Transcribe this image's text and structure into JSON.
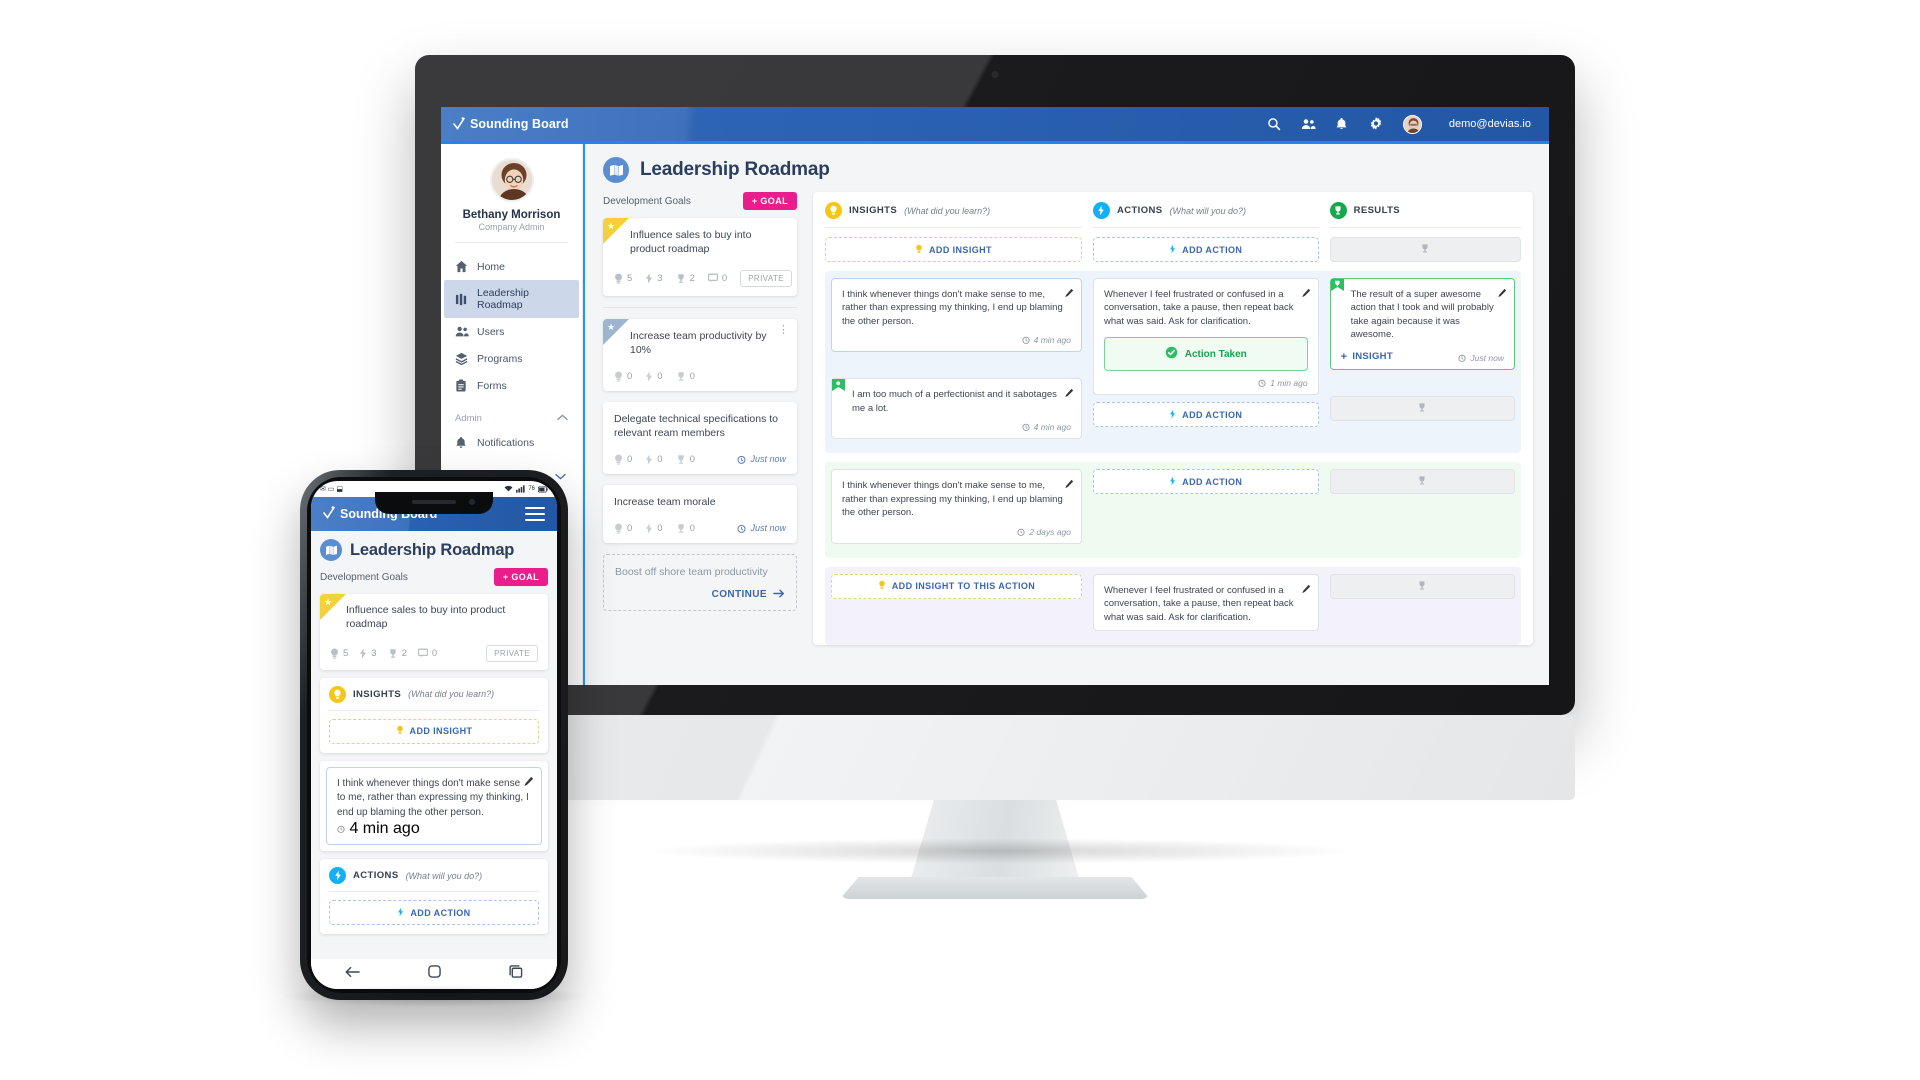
{
  "app": {
    "brand": "Sounding Board",
    "user_email": "demo@devias.io",
    "nav_icons": [
      "search-icon",
      "users-icon",
      "bell-icon",
      "gear-icon",
      "avatar"
    ]
  },
  "sidebar": {
    "profile_name": "Bethany Morrison",
    "profile_role": "Company Admin",
    "items": [
      {
        "label": "Home",
        "icon": "home-icon",
        "active": false
      },
      {
        "label": "Leadership Roadmap",
        "icon": "roadmap-icon",
        "active": true
      },
      {
        "label": "Users",
        "icon": "users-icon",
        "active": false
      },
      {
        "label": "Programs",
        "icon": "layers-icon",
        "active": false
      },
      {
        "label": "Forms",
        "icon": "clipboard-icon",
        "active": false
      }
    ],
    "group_label": "Admin",
    "admin_items": [
      {
        "label": "Notifications",
        "icon": "bell-icon"
      }
    ]
  },
  "page": {
    "title": "Leadership Roadmap",
    "icon": "map-book-icon"
  },
  "goals": {
    "section_label": "Development Goals",
    "add_button": "+ GOAL",
    "cards": [
      {
        "title": "Influence sales to buy into product roadmap",
        "flag": "yellow",
        "insights": "5",
        "actions": "3",
        "results": "2",
        "comments": "0",
        "badge": "PRIVATE",
        "time": ""
      },
      {
        "title": "Increase team productivity by 10%",
        "flag": "blue",
        "insights": "0",
        "actions": "0",
        "results": "0",
        "comments": null,
        "badge": null,
        "time": "",
        "menu": "kebab-icon"
      },
      {
        "title": "Delegate technical specifications to relevant ream members",
        "flag": null,
        "insights": "0",
        "actions": "0",
        "results": "0",
        "comments": null,
        "badge": null,
        "time": "Just now"
      },
      {
        "title": "Increase team morale",
        "flag": null,
        "insights": "0",
        "actions": "0",
        "results": "0",
        "comments": null,
        "badge": null,
        "time": "Just now"
      }
    ],
    "draft": {
      "title": "Boost off shore team productivity",
      "continue_label": "CONTINUE"
    }
  },
  "board": {
    "columns": [
      {
        "title": "INSIGHTS",
        "subtitle": "(What did you learn?)",
        "icon": "lightbulb-icon",
        "color": "#f5c518",
        "add_label": "ADD INSIGHT"
      },
      {
        "title": "ACTIONS",
        "subtitle": "(What will you do?)",
        "icon": "bolt-icon",
        "color": "#13b0f5",
        "add_label": "ADD ACTION"
      },
      {
        "title": "RESULTS",
        "subtitle": "",
        "icon": "trophy-icon",
        "color": "#16a84a",
        "add_label": ""
      }
    ],
    "rows": [
      {
        "tint": "blue",
        "insights": [
          {
            "text": "I think whenever things don't make sense to me, rather than expressing my thinking, I end up blaming the other person.",
            "time": "4 min ago",
            "flag": null
          },
          {
            "text": "I am too much of a perfectionist and it sabotages me a lot.",
            "time": "4 min ago",
            "flag": "green"
          }
        ],
        "actions": [
          {
            "text": "Whenever I feel frustrated or confused in a conversation, take a pause, then repeat back what was said. Ask for clarification.",
            "time": "1 min ago",
            "taken_label": "Action Taken"
          }
        ],
        "action_placeholder": "ADD ACTION",
        "results": [
          {
            "text": "The result of a super awesome action that I took and will probably take again because it was awesome.",
            "time": "Just now",
            "insight_link": "INSIGHT"
          }
        ],
        "result_placeholder": ""
      },
      {
        "tint": "green",
        "insights": [
          {
            "text": "I think whenever things don't make sense to me, rather than expressing my thinking, I end up blaming the other person.",
            "time": "2 days ago",
            "flag": null
          }
        ],
        "action_placeholder": "ADD ACTION",
        "result_placeholder": ""
      },
      {
        "tint": "lilac",
        "insight_placeholder": "ADD INSIGHT TO THIS ACTION",
        "actions": [
          {
            "text": "Whenever I feel frustrated or confused in a conversation, take a pause, then repeat back what was said. Ask for clarification.",
            "time": "",
            "taken_label": null
          }
        ],
        "result_placeholder": ""
      }
    ]
  },
  "phone": {
    "brand": "Sounding Board",
    "menu_icon": "hamburger-icon",
    "title": "Leadership Roadmap",
    "goals_label": "Development Goals",
    "add_goal": "+ GOAL",
    "card": {
      "title": "Influence sales to buy into product roadmap",
      "insights": "5",
      "actions": "3",
      "results": "2",
      "comments": "0",
      "badge": "PRIVATE"
    },
    "insights_section": {
      "title": "INSIGHTS",
      "subtitle": "(What did you learn?)",
      "add_label": "ADD INSIGHT"
    },
    "note": {
      "text": "I think whenever things don't make sense to me, rather than expressing my thinking, I end up blaming the other person.",
      "time": "4 min ago"
    },
    "actions_section": {
      "title": "ACTIONS",
      "subtitle": "(What will you do?)",
      "add_label": "ADD ACTION"
    }
  },
  "colors": {
    "brand_blue": "#2257a5",
    "accent_pink": "#e91e8c",
    "insight_yellow": "#f5c518",
    "action_blue": "#13b0f5",
    "result_green": "#16a84a",
    "link_blue": "#3a66b0"
  }
}
